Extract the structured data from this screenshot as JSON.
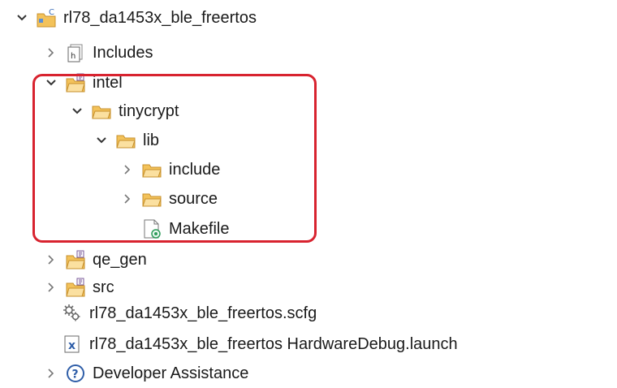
{
  "tree": {
    "project": {
      "label": "rl78_da1453x_ble_freertos",
      "icon": "c-project-icon",
      "expanded": true
    },
    "includes": {
      "label": "Includes",
      "icon": "includes-icon",
      "expanded": false
    },
    "intel": {
      "label": "intel",
      "icon": "source-folder-icon",
      "expanded": true
    },
    "tinycrypt": {
      "label": "tinycrypt",
      "icon": "folder-icon",
      "expanded": true
    },
    "lib": {
      "label": "lib",
      "icon": "folder-icon",
      "expanded": true
    },
    "include": {
      "label": "include",
      "icon": "folder-icon",
      "expanded": false
    },
    "source": {
      "label": "source",
      "icon": "folder-icon",
      "expanded": false
    },
    "makefile": {
      "label": "Makefile",
      "icon": "makefile-icon"
    },
    "qe_gen": {
      "label": "qe_gen",
      "icon": "source-folder-icon",
      "expanded": false
    },
    "src": {
      "label": "src",
      "icon": "source-folder-icon",
      "expanded": false
    },
    "scfg": {
      "label": "rl78_da1453x_ble_freertos.scfg",
      "icon": "gear-file-icon"
    },
    "launch": {
      "label": "rl78_da1453x_ble_freertos HardwareDebug.launch",
      "icon": "launch-file-icon"
    },
    "developer": {
      "label": "Developer Assistance",
      "icon": "help-icon",
      "expanded": false
    }
  },
  "colors": {
    "highlight": "#d8232f",
    "folder": "#f3c25a",
    "folder_stroke": "#c7902c"
  }
}
